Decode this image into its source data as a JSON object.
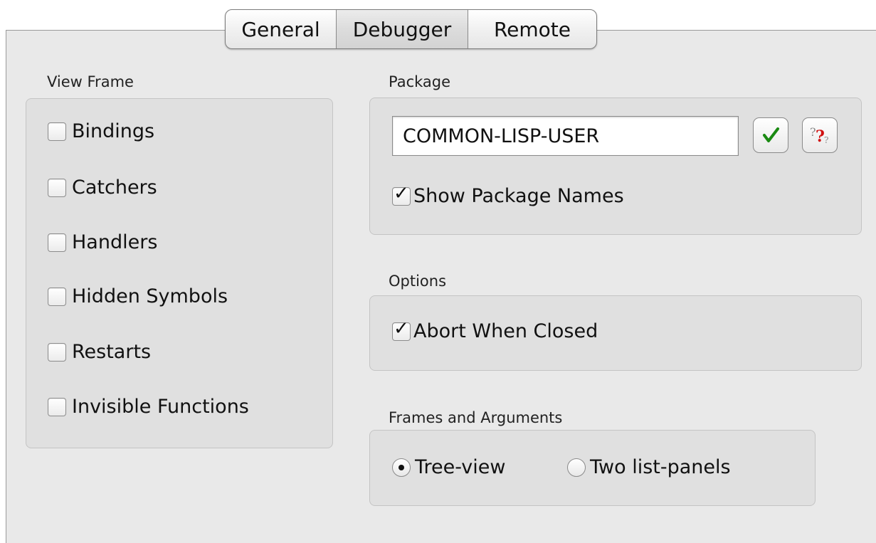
{
  "tabs": [
    {
      "label": "General",
      "selected": false
    },
    {
      "label": "Debugger",
      "selected": true
    },
    {
      "label": "Remote",
      "selected": false
    }
  ],
  "view_frame": {
    "label": "View Frame",
    "items": [
      {
        "label": "Bindings",
        "checked": false
      },
      {
        "label": "Catchers",
        "checked": false
      },
      {
        "label": "Handlers",
        "checked": false
      },
      {
        "label": "Hidden Symbols",
        "checked": false
      },
      {
        "label": "Restarts",
        "checked": false
      },
      {
        "label": "Invisible Functions",
        "checked": false
      }
    ]
  },
  "package": {
    "label": "Package",
    "value": "COMMON-LISP-USER",
    "show_package_names": {
      "label": "Show Package Names",
      "checked": true
    },
    "ok_icon": "green-checkmark-icon",
    "help_icon": "question-mark-icon"
  },
  "options": {
    "label": "Options",
    "abort_when_closed": {
      "label": "Abort When Closed",
      "checked": true
    }
  },
  "frames_and_arguments": {
    "label": "Frames and Arguments",
    "options": [
      {
        "label": "Tree-view",
        "selected": true
      },
      {
        "label": "Two list-panels",
        "selected": false
      }
    ]
  },
  "colors": {
    "pane_bg": "#e9e9e9",
    "box_bg": "#e0e0e0",
    "check_green": "#1a8a12",
    "help_red": "#d01010"
  }
}
